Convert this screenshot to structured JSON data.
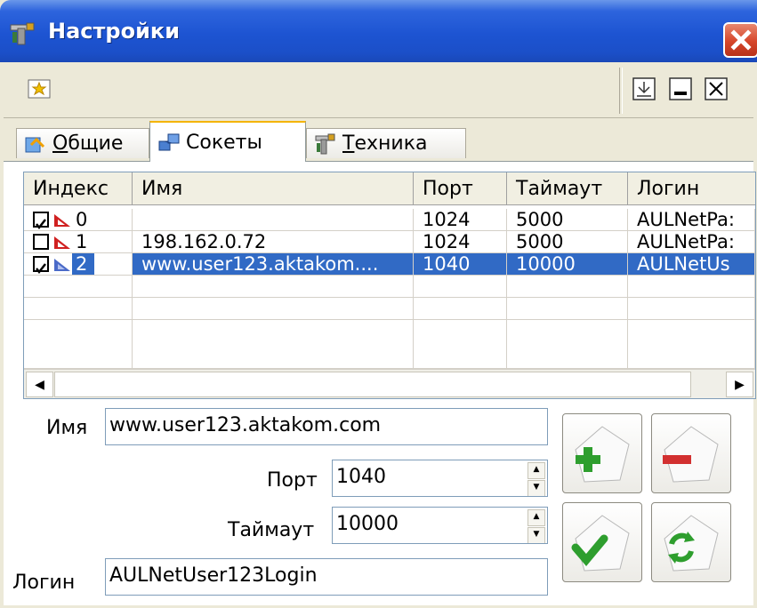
{
  "window": {
    "title": "Настройки",
    "close_label": "✕"
  },
  "toolbar": {
    "minimize": "_",
    "maximize": "",
    "close": "X"
  },
  "tabs": [
    {
      "label_prefix": "",
      "label_underline": "О",
      "label_rest": "бщие",
      "active": false
    },
    {
      "label_prefix": "",
      "label_underline": "",
      "label_rest": "Сокеты",
      "active": true
    },
    {
      "label_prefix": "",
      "label_underline": "Т",
      "label_rest": "ехника",
      "active": false
    }
  ],
  "grid": {
    "headers": [
      "Индекс",
      "Имя",
      "Порт",
      "Таймаут",
      "Логин"
    ],
    "rows": [
      {
        "checked": true,
        "index": "0",
        "name": "",
        "port": "1024",
        "timeout": "5000",
        "login": "AULNetPa:",
        "selected": false
      },
      {
        "checked": false,
        "index": "1",
        "name": "198.162.0.72",
        "port": "1024",
        "timeout": "5000",
        "login": "AULNetPa:",
        "selected": false
      },
      {
        "checked": true,
        "index": "2",
        "name": "www.user123.aktakom....",
        "port": "1040",
        "timeout": "10000",
        "login": "AULNetUs",
        "selected": true
      }
    ],
    "scroll_left": "◀",
    "scroll_right": "▶"
  },
  "form": {
    "name_label": "Имя",
    "name_value": "www.user123.aktakom.com",
    "port_label": "Порт",
    "port_value": "1040",
    "timeout_label": "Таймаут",
    "timeout_value": "10000",
    "login_label": "Логин",
    "login_value": "AULNetUser123Login",
    "spin_up": "▲",
    "spin_down": "▼"
  },
  "colors": {
    "titlebar": "#1d54d2",
    "selection": "#316ac5",
    "add": "#2e9e2e",
    "remove": "#d23030"
  }
}
